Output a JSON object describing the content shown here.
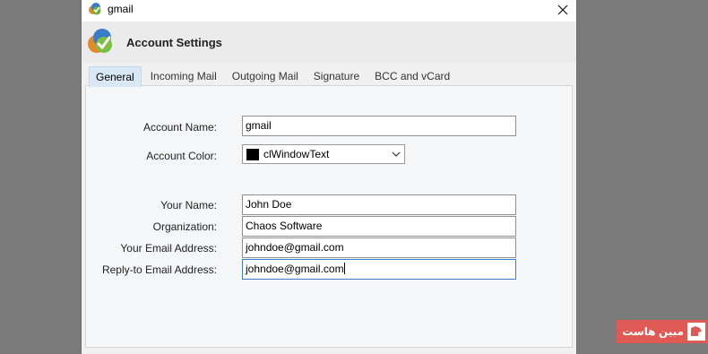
{
  "window": {
    "title": "gmail",
    "close_label": "✕"
  },
  "header": {
    "title": "Account Settings"
  },
  "tabs": [
    {
      "label": "General",
      "active": true
    },
    {
      "label": "Incoming Mail",
      "active": false
    },
    {
      "label": "Outgoing Mail",
      "active": false
    },
    {
      "label": "Signature",
      "active": false
    },
    {
      "label": "BCC and vCard",
      "active": false
    }
  ],
  "form": {
    "account_name": {
      "label": "Account Name:",
      "value": "gmail"
    },
    "account_color": {
      "label": "Account Color:",
      "value": "clWindowText",
      "swatch": "#000000"
    },
    "your_name": {
      "label": "Your Name:",
      "value": "John Doe"
    },
    "organization": {
      "label": "Organization:",
      "value": "Chaos Software"
    },
    "email": {
      "label": "Your Email Address:",
      "value": "johndoe@gmail.com"
    },
    "reply_to": {
      "label": "Reply-to Email Address:",
      "value": "johndoe@gmail.com"
    }
  },
  "watermark": {
    "text": "مبین هاست"
  },
  "colors": {
    "accent": "#3c7fd0",
    "tab_active": "#d8e8f7",
    "watermark": "#e05a55"
  }
}
